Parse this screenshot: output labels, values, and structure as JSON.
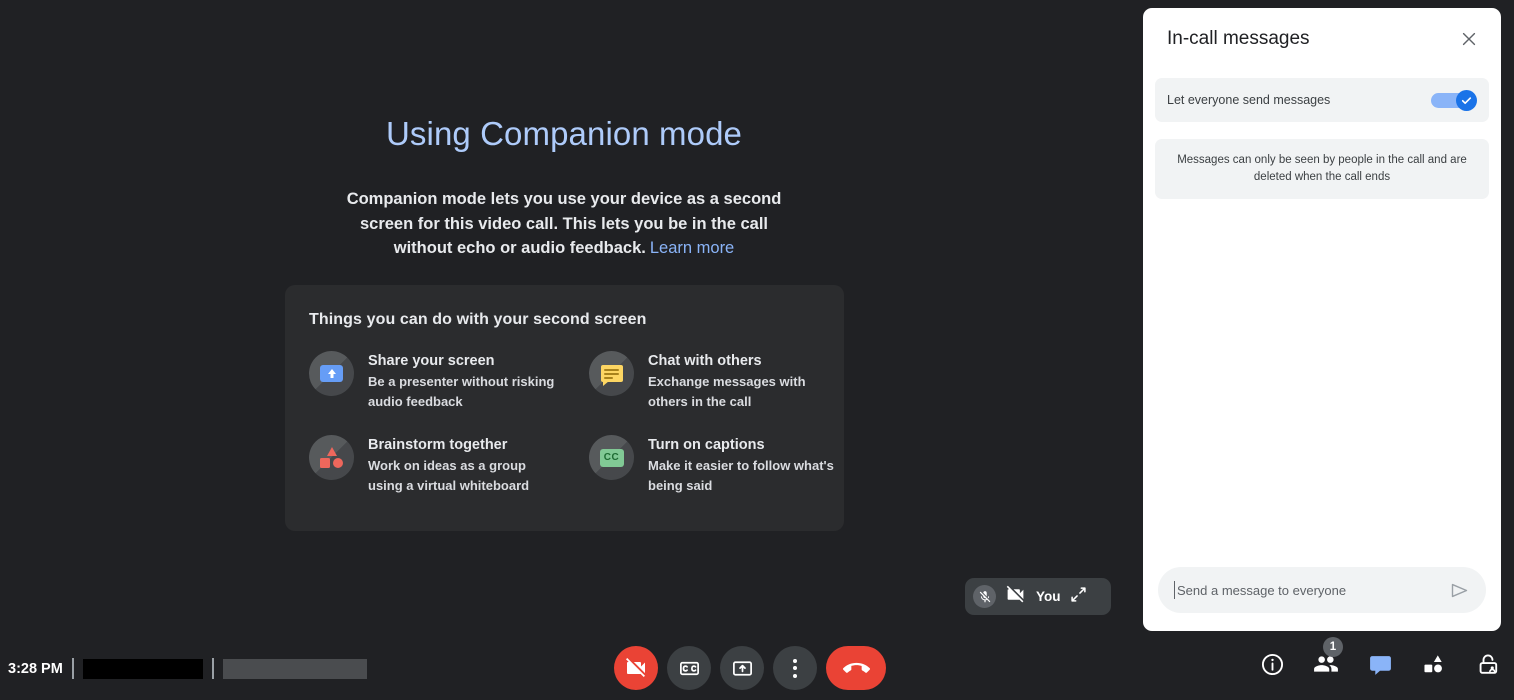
{
  "stage": {
    "hero_title": "Using Companion mode",
    "hero_body": "Companion mode lets you use your device as a second screen for this video call. This lets you be in the call without echo or audio feedback.",
    "learn_more": "Learn more",
    "features_title": "Things you can do with your second screen",
    "features": [
      {
        "icon": "screen-share-icon",
        "heading": "Share your screen",
        "description": "Be a presenter without risking audio feedback"
      },
      {
        "icon": "chat-bubble-icon",
        "heading": "Chat with others",
        "description": "Exchange messages with others in the call"
      },
      {
        "icon": "shapes-whiteboard-icon",
        "heading": "Brainstorm together",
        "description": "Work on ideas as a group using a virtual whiteboard"
      },
      {
        "icon": "closed-captions-icon",
        "heading": "Turn on captions",
        "description": "Make it easier to follow what's being said",
        "cc_label": "CC"
      }
    ],
    "self_tile": {
      "name": "You",
      "mic_icon": "mic-off-icon",
      "camera_icon": "camera-off-icon",
      "expand_icon": "expand-icon"
    }
  },
  "taskbar": {
    "time": "3:28 PM"
  },
  "controls": [
    {
      "name": "camera-toggle-button",
      "icon": "camera-off-icon",
      "style": "danger"
    },
    {
      "name": "captions-button",
      "icon": "closed-captions-icon",
      "style": "neutral"
    },
    {
      "name": "present-screen-button",
      "icon": "present-screen-icon",
      "style": "neutral"
    },
    {
      "name": "more-options-button",
      "icon": "more-vertical-icon",
      "style": "neutral"
    },
    {
      "name": "leave-call-button",
      "icon": "hangup-icon",
      "style": "hangup"
    }
  ],
  "right_tools": [
    {
      "name": "meeting-details-button",
      "icon": "info-icon"
    },
    {
      "name": "people-button",
      "icon": "people-icon",
      "badge": "1"
    },
    {
      "name": "chat-button",
      "icon": "chat-icon",
      "active": true,
      "color": "#8ab4f8"
    },
    {
      "name": "activities-button",
      "icon": "activities-shapes-icon"
    },
    {
      "name": "host-controls-button",
      "icon": "lock-person-icon"
    }
  ],
  "panel": {
    "title": "In-call messages",
    "close_icon": "close-icon",
    "toggle": {
      "label": "Let everyone send messages",
      "enabled": true,
      "accent": "#1a73e8"
    },
    "info_text": "Messages can only be seen by people in the call and are deleted when the call ends",
    "composer": {
      "value": "",
      "placeholder": "Send a message to everyone",
      "send_icon": "send-icon"
    }
  }
}
